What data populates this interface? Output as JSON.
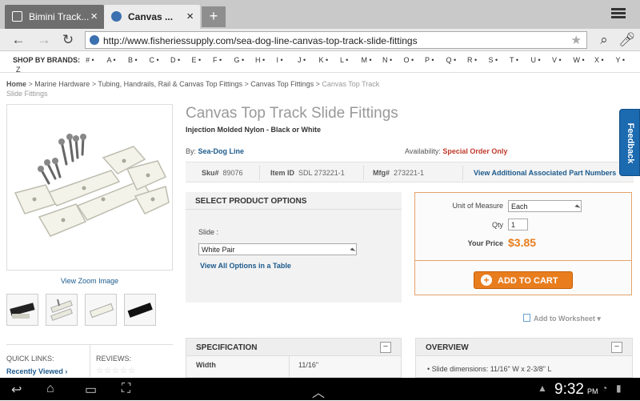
{
  "browser": {
    "tabs": [
      {
        "label": "Bimini Track..."
      },
      {
        "label": "Canvas ..."
      }
    ],
    "new_tab": "+",
    "url": "http://www.fisheriessupply.com/sea-dog-line-canvas-top-track-slide-fittings"
  },
  "brands": {
    "label": "SHOP BY BRANDS:",
    "letters": [
      "#",
      "A",
      "B",
      "C",
      "D",
      "E",
      "F",
      "G",
      "H",
      "I",
      "J",
      "K",
      "L",
      "M",
      "N",
      "O",
      "P",
      "Q",
      "R",
      "S",
      "T",
      "U",
      "V",
      "W",
      "X",
      "Y"
    ],
    "last": "Z"
  },
  "breadcrumb": {
    "home": "Home",
    "items": [
      "Marine Hardware",
      "Tubing, Handrails, Rail & Canvas Top Fittings",
      "Canvas Top Fittings"
    ],
    "current": "Canvas Top Track Slide Fittings",
    "sep": " > "
  },
  "gallery": {
    "zoom_link": "View Zoom Image"
  },
  "quick": {
    "quick_links": "QUICK LINKS:",
    "recently_viewed": "Recently Viewed",
    "reviews": "REVIEWS:",
    "stars": "☆☆☆☆☆"
  },
  "product": {
    "title": "Canvas Top Track Slide Fittings",
    "subtitle": "Injection Molded Nylon - Black or White",
    "by_label": "By:",
    "brand": "Sea-Dog Line",
    "availability_label": "Availability:",
    "availability": "Special Order Only",
    "sku_label": "Sku#",
    "sku": "89076",
    "item_label": "Item ID",
    "item_id": "SDL 273221-1",
    "mfg_label": "Mfg#",
    "mfg": "273221-1",
    "parts_link": "View Additional Associated Part Numbers"
  },
  "options": {
    "header": "SELECT PRODUCT OPTIONS",
    "slide_label": "Slide :",
    "slide_value": "White Pair",
    "table_link": "View All Options in a Table"
  },
  "cart": {
    "uom_label": "Unit of Measure",
    "uom_value": "Each",
    "qty_label": "Qty",
    "qty_value": "1",
    "price_label": "Your Price",
    "price": "$3.85",
    "add_label": "ADD TO CART"
  },
  "worksheet": {
    "label": "Add to Worksheet"
  },
  "feedback": "Feedback",
  "spec": {
    "header": "SPECIFICATION",
    "row_key": "Width",
    "row_value": "11/16\""
  },
  "overview": {
    "header": "OVERVIEW",
    "item": "• Slide dimensions: 11/16\" W x 2-3/8\" L"
  },
  "system": {
    "time": "9:32",
    "ampm": "PM"
  },
  "colors": {
    "accent_orange": "#e87d1e",
    "link_blue": "#1c5a8c",
    "alert_red": "#c0392b"
  }
}
